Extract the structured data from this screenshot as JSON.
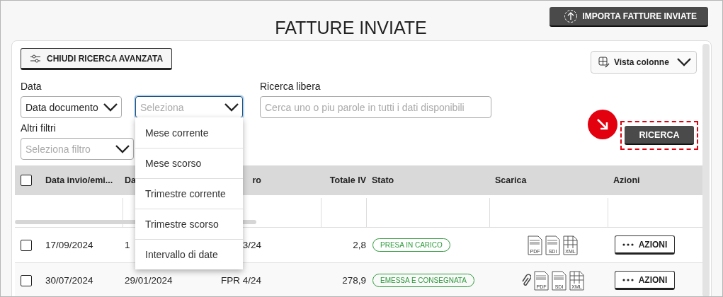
{
  "page": {
    "title": "FATTURE INVIATE",
    "import_button": "IMPORTA FATTURE INVIATE"
  },
  "filters": {
    "toggle_button": "CHIUDI RICERCA AVANZATA",
    "columns_button": "Vista colonne",
    "date_label": "Data",
    "date_type": "Data documento",
    "period_placeholder": "Seleziona",
    "period_open": true,
    "free_search_label": "Ricerca libera",
    "free_search_placeholder": "Cerca uno o piu parole in tutti i dati disponibili",
    "other_label": "Altri filtri",
    "other_placeholder": "Seleziona filtro",
    "search_button": "RICERCA",
    "search_highlighted": true
  },
  "period_menu": [
    {
      "label": "Mese corrente"
    },
    {
      "label": "Mese scorso"
    },
    {
      "label": "Trimestre corrente"
    },
    {
      "label": "Trimestre scorso"
    },
    {
      "label": "Intervallo di date"
    }
  ],
  "table": {
    "select_all": false,
    "columns": [
      "Data invio/emi...",
      "Da",
      "ro",
      "Totale IV",
      "Stato",
      "Scarica",
      "Azioni"
    ],
    "rows": [
      {
        "checked": false,
        "cells": [
          "17/09/2024",
          "1",
          "3/24",
          "2,8"
        ],
        "status": "PRESA IN CARICO",
        "attachment": false,
        "downloads": [
          "PDF",
          "SDI",
          "XML"
        ],
        "action": "AZIONI"
      },
      {
        "checked": false,
        "cells": [
          "30/07/2024",
          "29/01/2024",
          "FPR 4/24",
          "278,9"
        ],
        "status": "EMESSA E CONSEGNATA",
        "attachment": true,
        "downloads": [
          "PDF",
          "SDI",
          "XML"
        ],
        "action": "AZIONI"
      }
    ]
  }
}
